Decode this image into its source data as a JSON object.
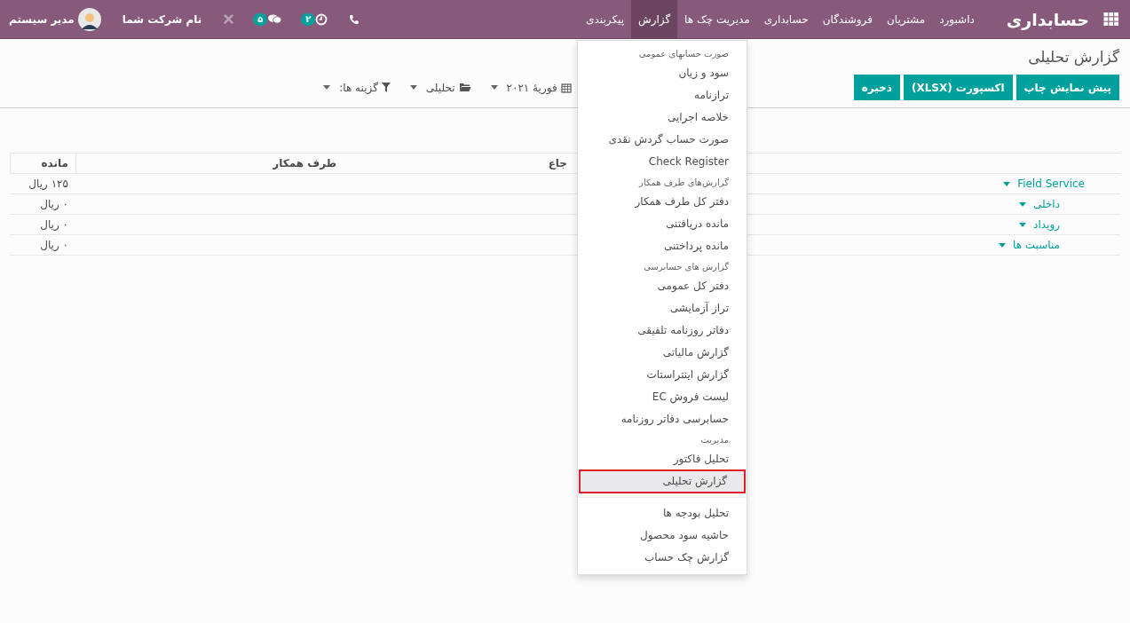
{
  "navbar": {
    "brand": "حسابداری",
    "menu": [
      {
        "label": "داشبورد",
        "selected": false
      },
      {
        "label": "مشتریان",
        "selected": false
      },
      {
        "label": "فروشندگان",
        "selected": false
      },
      {
        "label": "حسابداری",
        "selected": false
      },
      {
        "label": "مدیریت چک ها",
        "selected": false
      },
      {
        "label": "گزارش",
        "selected": true
      },
      {
        "label": "پیکربندی",
        "selected": false
      }
    ],
    "activity_badge": "۲",
    "messages_badge": "۵",
    "company": "نام شرکت شما",
    "user": "مدیر سیستم"
  },
  "control_panel": {
    "title": "گزارش تحلیلی",
    "buttons": [
      "پیش نمایش چاپ",
      "اکسپورت (XLSX)",
      "ذخیره"
    ],
    "filters": [
      {
        "kind": "date",
        "label": "فوریهٔ ۲۰۲۱"
      },
      {
        "kind": "folder",
        "label": "تحلیلی"
      },
      {
        "kind": "filter",
        "label": "گزینه ها:"
      }
    ]
  },
  "table": {
    "columns": [
      "",
      "جاع",
      "طرف همکار",
      "مانده"
    ],
    "rows": [
      {
        "name": "Field Service",
        "balance": "۱۲۵ ریال",
        "children": [
          {
            "name": "داخلی",
            "balance": "۰ ریال"
          },
          {
            "name": "رویداد",
            "balance": "۰ ریال"
          },
          {
            "name": "مناسبت ها",
            "balance": "۰ ریال"
          }
        ]
      }
    ]
  },
  "dropdown": [
    {
      "kind": "header",
      "label": "صورت حسابهای عمومی"
    },
    {
      "kind": "item",
      "label": "سود و زیان",
      "selected": false
    },
    {
      "kind": "item",
      "label": "ترازنامه",
      "selected": false
    },
    {
      "kind": "item",
      "label": "خلاصه اجرایی",
      "selected": false
    },
    {
      "kind": "item",
      "label": "صورت حساب گردش نقدی",
      "selected": false
    },
    {
      "kind": "item",
      "label": "Check Register",
      "selected": false
    },
    {
      "kind": "header",
      "label": "گزارش‌های طرف همکار"
    },
    {
      "kind": "item",
      "label": "دفتر کل طرف همکار",
      "selected": false
    },
    {
      "kind": "item",
      "label": "مانده دریافتنی",
      "selected": false
    },
    {
      "kind": "item",
      "label": "مانده پرداختنی",
      "selected": false
    },
    {
      "kind": "header",
      "label": "گزارش های حسابرسی"
    },
    {
      "kind": "item",
      "label": "دفتر کل عمومی",
      "selected": false
    },
    {
      "kind": "item",
      "label": "تراز آزمایشی",
      "selected": false
    },
    {
      "kind": "item",
      "label": "دفاتر روزنامه تلفیقی",
      "selected": false
    },
    {
      "kind": "item",
      "label": "گزارش مالیاتی",
      "selected": false
    },
    {
      "kind": "item",
      "label": "گزارش اینتراستات",
      "selected": false
    },
    {
      "kind": "item",
      "label": "لیست فروش EC",
      "selected": false
    },
    {
      "kind": "item",
      "label": "حسابرسی دفاتر روزنامه",
      "selected": false
    },
    {
      "kind": "header",
      "label": "مدیریت"
    },
    {
      "kind": "item",
      "label": "تحلیل فاکتور",
      "selected": false
    },
    {
      "kind": "item",
      "label": "گزارش تحلیلی",
      "selected": true
    },
    {
      "kind": "divider"
    },
    {
      "kind": "item",
      "label": "تحلیل بودجه ها",
      "selected": false
    },
    {
      "kind": "item",
      "label": "حاشیه سود محصول",
      "selected": false
    },
    {
      "kind": "item",
      "label": "گزارش چک حساب",
      "selected": false
    }
  ]
}
